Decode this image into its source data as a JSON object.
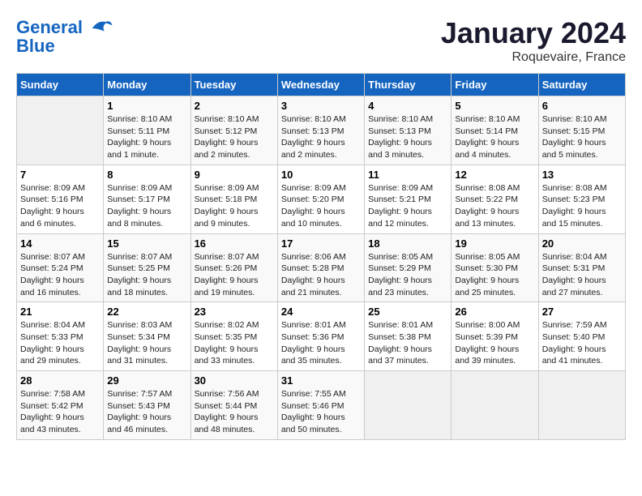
{
  "header": {
    "logo_line1": "General",
    "logo_line2": "Blue",
    "month_title": "January 2024",
    "location": "Roquevaire, France"
  },
  "weekdays": [
    "Sunday",
    "Monday",
    "Tuesday",
    "Wednesday",
    "Thursday",
    "Friday",
    "Saturday"
  ],
  "weeks": [
    [
      {
        "day": "",
        "info": ""
      },
      {
        "day": "1",
        "info": "Sunrise: 8:10 AM\nSunset: 5:11 PM\nDaylight: 9 hours\nand 1 minute."
      },
      {
        "day": "2",
        "info": "Sunrise: 8:10 AM\nSunset: 5:12 PM\nDaylight: 9 hours\nand 2 minutes."
      },
      {
        "day": "3",
        "info": "Sunrise: 8:10 AM\nSunset: 5:13 PM\nDaylight: 9 hours\nand 2 minutes."
      },
      {
        "day": "4",
        "info": "Sunrise: 8:10 AM\nSunset: 5:13 PM\nDaylight: 9 hours\nand 3 minutes."
      },
      {
        "day": "5",
        "info": "Sunrise: 8:10 AM\nSunset: 5:14 PM\nDaylight: 9 hours\nand 4 minutes."
      },
      {
        "day": "6",
        "info": "Sunrise: 8:10 AM\nSunset: 5:15 PM\nDaylight: 9 hours\nand 5 minutes."
      }
    ],
    [
      {
        "day": "7",
        "info": "Sunrise: 8:09 AM\nSunset: 5:16 PM\nDaylight: 9 hours\nand 6 minutes."
      },
      {
        "day": "8",
        "info": "Sunrise: 8:09 AM\nSunset: 5:17 PM\nDaylight: 9 hours\nand 8 minutes."
      },
      {
        "day": "9",
        "info": "Sunrise: 8:09 AM\nSunset: 5:18 PM\nDaylight: 9 hours\nand 9 minutes."
      },
      {
        "day": "10",
        "info": "Sunrise: 8:09 AM\nSunset: 5:20 PM\nDaylight: 9 hours\nand 10 minutes."
      },
      {
        "day": "11",
        "info": "Sunrise: 8:09 AM\nSunset: 5:21 PM\nDaylight: 9 hours\nand 12 minutes."
      },
      {
        "day": "12",
        "info": "Sunrise: 8:08 AM\nSunset: 5:22 PM\nDaylight: 9 hours\nand 13 minutes."
      },
      {
        "day": "13",
        "info": "Sunrise: 8:08 AM\nSunset: 5:23 PM\nDaylight: 9 hours\nand 15 minutes."
      }
    ],
    [
      {
        "day": "14",
        "info": "Sunrise: 8:07 AM\nSunset: 5:24 PM\nDaylight: 9 hours\nand 16 minutes."
      },
      {
        "day": "15",
        "info": "Sunrise: 8:07 AM\nSunset: 5:25 PM\nDaylight: 9 hours\nand 18 minutes."
      },
      {
        "day": "16",
        "info": "Sunrise: 8:07 AM\nSunset: 5:26 PM\nDaylight: 9 hours\nand 19 minutes."
      },
      {
        "day": "17",
        "info": "Sunrise: 8:06 AM\nSunset: 5:28 PM\nDaylight: 9 hours\nand 21 minutes."
      },
      {
        "day": "18",
        "info": "Sunrise: 8:05 AM\nSunset: 5:29 PM\nDaylight: 9 hours\nand 23 minutes."
      },
      {
        "day": "19",
        "info": "Sunrise: 8:05 AM\nSunset: 5:30 PM\nDaylight: 9 hours\nand 25 minutes."
      },
      {
        "day": "20",
        "info": "Sunrise: 8:04 AM\nSunset: 5:31 PM\nDaylight: 9 hours\nand 27 minutes."
      }
    ],
    [
      {
        "day": "21",
        "info": "Sunrise: 8:04 AM\nSunset: 5:33 PM\nDaylight: 9 hours\nand 29 minutes."
      },
      {
        "day": "22",
        "info": "Sunrise: 8:03 AM\nSunset: 5:34 PM\nDaylight: 9 hours\nand 31 minutes."
      },
      {
        "day": "23",
        "info": "Sunrise: 8:02 AM\nSunset: 5:35 PM\nDaylight: 9 hours\nand 33 minutes."
      },
      {
        "day": "24",
        "info": "Sunrise: 8:01 AM\nSunset: 5:36 PM\nDaylight: 9 hours\nand 35 minutes."
      },
      {
        "day": "25",
        "info": "Sunrise: 8:01 AM\nSunset: 5:38 PM\nDaylight: 9 hours\nand 37 minutes."
      },
      {
        "day": "26",
        "info": "Sunrise: 8:00 AM\nSunset: 5:39 PM\nDaylight: 9 hours\nand 39 minutes."
      },
      {
        "day": "27",
        "info": "Sunrise: 7:59 AM\nSunset: 5:40 PM\nDaylight: 9 hours\nand 41 minutes."
      }
    ],
    [
      {
        "day": "28",
        "info": "Sunrise: 7:58 AM\nSunset: 5:42 PM\nDaylight: 9 hours\nand 43 minutes."
      },
      {
        "day": "29",
        "info": "Sunrise: 7:57 AM\nSunset: 5:43 PM\nDaylight: 9 hours\nand 46 minutes."
      },
      {
        "day": "30",
        "info": "Sunrise: 7:56 AM\nSunset: 5:44 PM\nDaylight: 9 hours\nand 48 minutes."
      },
      {
        "day": "31",
        "info": "Sunrise: 7:55 AM\nSunset: 5:46 PM\nDaylight: 9 hours\nand 50 minutes."
      },
      {
        "day": "",
        "info": ""
      },
      {
        "day": "",
        "info": ""
      },
      {
        "day": "",
        "info": ""
      }
    ]
  ]
}
